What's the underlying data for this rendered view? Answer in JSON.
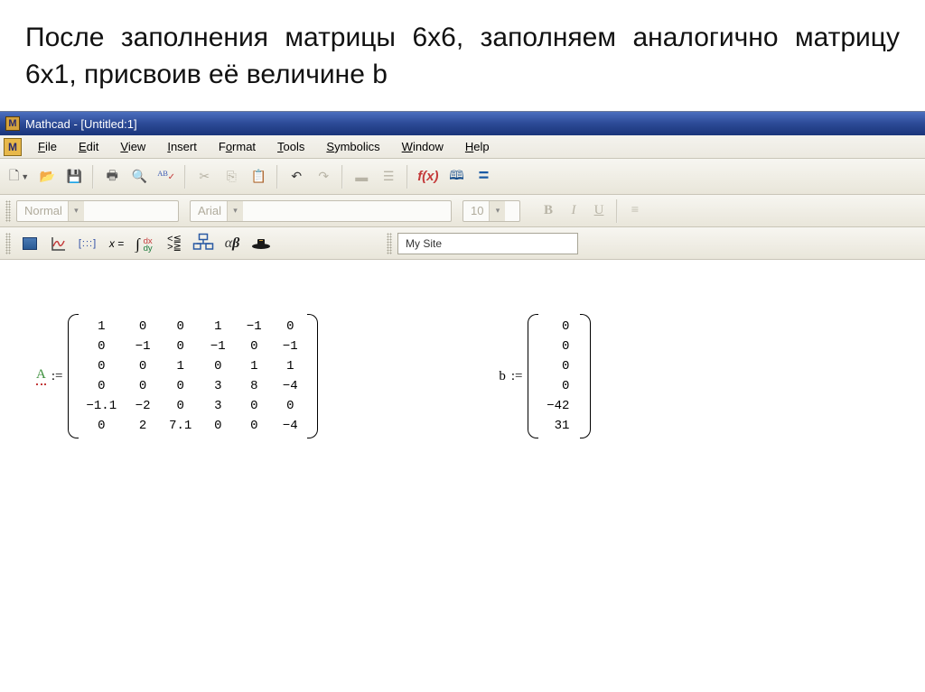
{
  "slide_title": "После заполнения матрицы 6х6, заполняем аналогично матрицу 6х1, присвоив её величине b",
  "window": {
    "title": "Mathcad - [Untitled:1]"
  },
  "menubar": {
    "file": "File",
    "edit": "Edit",
    "view": "View",
    "insert": "Insert",
    "format": "Format",
    "tools": "Tools",
    "symbolics": "Symbolics",
    "window": "Window",
    "help": "Help"
  },
  "toolbar_names": {
    "new": "new-document-icon",
    "open": "open-folder-icon",
    "save": "save-disk-icon",
    "print": "print-icon",
    "preview": "print-preview-icon",
    "spell": "spellcheck-icon",
    "cut": "cut-icon",
    "copy": "copy-icon",
    "paste": "paste-icon",
    "undo": "undo-icon",
    "redo": "redo-icon",
    "align": "align-icon",
    "fx": "insert-function-icon",
    "unit": "insert-unit-icon",
    "equals": "evaluate-icon"
  },
  "fmtbar": {
    "style": "Normal",
    "font": "Arial",
    "size": "10",
    "bold": "B",
    "italic": "I",
    "underline": "U"
  },
  "mathbar": {
    "calc": "calculator-toolbar-icon",
    "graph": "graph-toolbar-icon",
    "matrix": "matrix-toolbar-icon",
    "eval": "evaluation-toolbar-icon",
    "calculus": "calculus-toolbar-icon",
    "bool": "boolean-toolbar-icon",
    "prog": "programming-toolbar-icon",
    "greek": "greek-toolbar-icon",
    "symbolic": "symbolic-toolbar-icon",
    "mysite": "My Site"
  },
  "worksheet": {
    "var_a": "A",
    "assign": ":=",
    "matrix_a": [
      [
        "1",
        "0",
        "0",
        "1",
        "−1",
        "0"
      ],
      [
        "0",
        "−1",
        "0",
        "−1",
        "0",
        "−1"
      ],
      [
        "0",
        "0",
        "1",
        "0",
        "1",
        "1"
      ],
      [
        "0",
        "0",
        "0",
        "3",
        "8",
        "−4"
      ],
      [
        "−1.1",
        "−2",
        "0",
        "3",
        "0",
        "0"
      ],
      [
        "0",
        "2",
        "7.1",
        "0",
        "0",
        "−4"
      ]
    ],
    "var_b": "b",
    "vector_b": [
      "0",
      "0",
      "0",
      "0",
      "−42",
      "31"
    ]
  }
}
